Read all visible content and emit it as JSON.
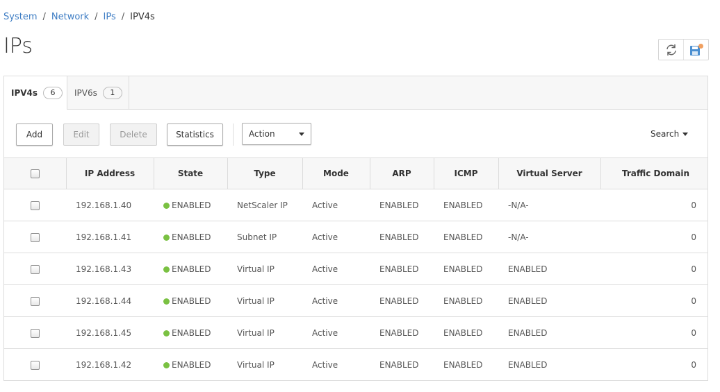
{
  "breadcrumb": {
    "items": [
      {
        "label": "System"
      },
      {
        "label": "Network"
      },
      {
        "label": "IPs"
      }
    ],
    "separator": "/",
    "current": "IPV4s"
  },
  "page": {
    "title": "IPs"
  },
  "top_actions": {
    "refresh_icon": "refresh-icon",
    "save_icon": "save-config-icon"
  },
  "tabs": [
    {
      "label": "IPV4s",
      "count": "6"
    },
    {
      "label": "IPV6s",
      "count": "1"
    }
  ],
  "toolbar": {
    "add": "Add",
    "edit": "Edit",
    "delete": "Delete",
    "statistics": "Statistics",
    "action": "Action",
    "search": "Search"
  },
  "table": {
    "columns": [
      "IP Address",
      "State",
      "Type",
      "Mode",
      "ARP",
      "ICMP",
      "Virtual Server",
      "Traffic Domain"
    ],
    "rows": [
      {
        "ip": "192.168.1.40",
        "state": "ENABLED",
        "type": "NetScaler IP",
        "mode": "Active",
        "arp": "ENABLED",
        "icmp": "ENABLED",
        "vserver": "-N/A-",
        "td": "0"
      },
      {
        "ip": "192.168.1.41",
        "state": "ENABLED",
        "type": "Subnet IP",
        "mode": "Active",
        "arp": "ENABLED",
        "icmp": "ENABLED",
        "vserver": "-N/A-",
        "td": "0"
      },
      {
        "ip": "192.168.1.43",
        "state": "ENABLED",
        "type": "Virtual IP",
        "mode": "Active",
        "arp": "ENABLED",
        "icmp": "ENABLED",
        "vserver": "ENABLED",
        "td": "0"
      },
      {
        "ip": "192.168.1.44",
        "state": "ENABLED",
        "type": "Virtual IP",
        "mode": "Active",
        "arp": "ENABLED",
        "icmp": "ENABLED",
        "vserver": "ENABLED",
        "td": "0"
      },
      {
        "ip": "192.168.1.45",
        "state": "ENABLED",
        "type": "Virtual IP",
        "mode": "Active",
        "arp": "ENABLED",
        "icmp": "ENABLED",
        "vserver": "ENABLED",
        "td": "0"
      },
      {
        "ip": "192.168.1.42",
        "state": "ENABLED",
        "type": "Virtual IP",
        "mode": "Active",
        "arp": "ENABLED",
        "icmp": "ENABLED",
        "vserver": "ENABLED",
        "td": "0"
      }
    ]
  },
  "colors": {
    "link": "#3e7dc4",
    "status_enabled": "#7ac142",
    "save_badge": "#f0a060"
  }
}
